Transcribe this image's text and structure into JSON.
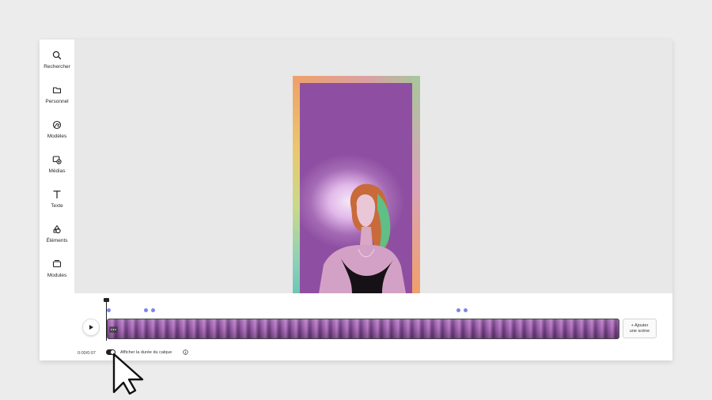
{
  "sidebar": {
    "items": [
      {
        "label": "Rechercher",
        "icon": "search-icon"
      },
      {
        "label": "Personnel",
        "icon": "folder-icon"
      },
      {
        "label": "Modèles",
        "icon": "templates-icon"
      },
      {
        "label": "Médias",
        "icon": "media-icon"
      },
      {
        "label": "Texte",
        "icon": "text-icon"
      },
      {
        "label": "Éléments",
        "icon": "shapes-icon"
      },
      {
        "label": "Modules",
        "icon": "modules-icon"
      }
    ]
  },
  "timeline": {
    "time": "0:00/0:07",
    "add_scene_line1": "+ Ajouter",
    "add_scene_line2": "une scène",
    "toggle_label": "Afficher la durée du calque",
    "toggle_on": true,
    "marker_color": "#7b86e8"
  },
  "colors": {
    "background": "#ececec",
    "canvas": "#e8e8e8",
    "accent": "#7b86e8"
  }
}
